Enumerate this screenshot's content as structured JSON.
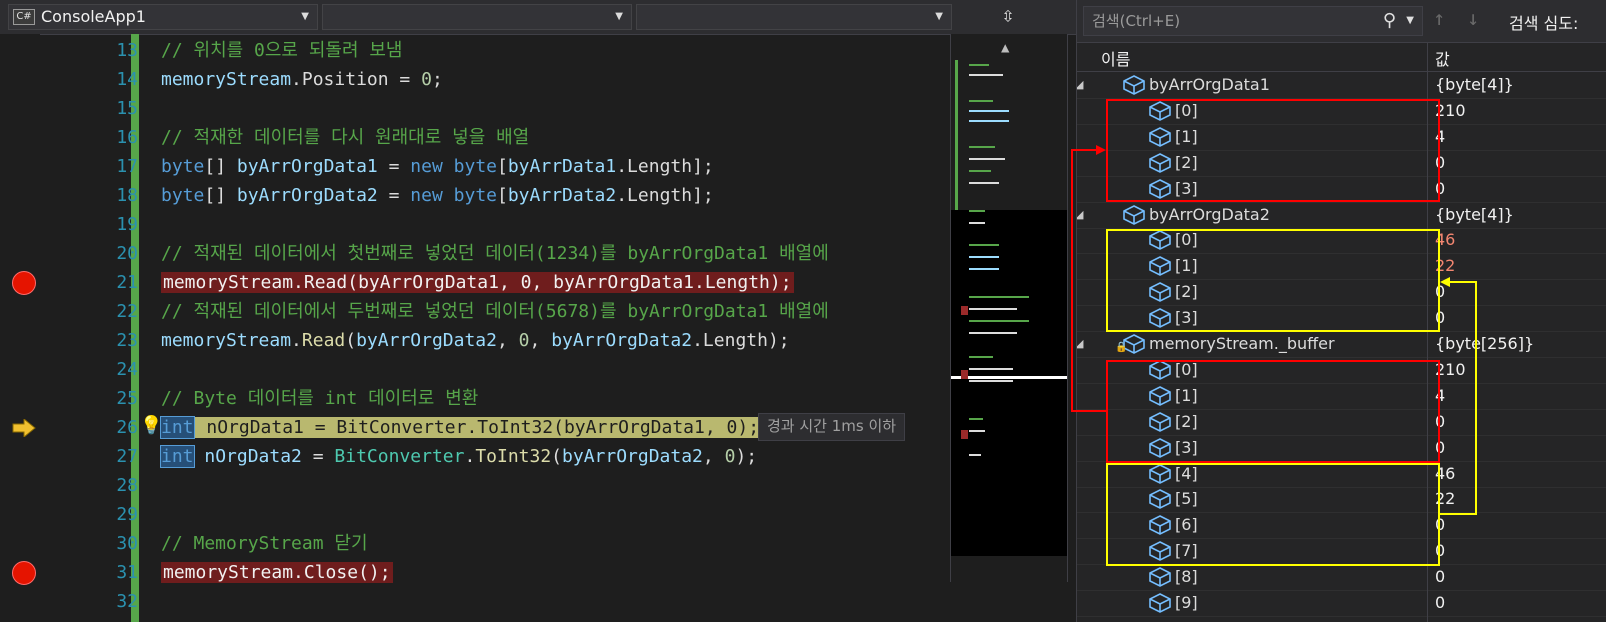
{
  "editor": {
    "nav": {
      "project": "ConsoleApp1",
      "project_icon": "C#",
      "type": "",
      "member": ""
    },
    "lines": [
      {
        "num": "13",
        "tokens": [
          {
            "t": "// 위치를 0으로 되돌려 보냄",
            "c": "comment"
          }
        ]
      },
      {
        "num": "14",
        "tokens": [
          {
            "t": "memoryStream",
            "c": "id"
          },
          {
            "t": ".Position = ",
            "c": "plain"
          },
          {
            "t": "0",
            "c": "num"
          },
          {
            "t": ";",
            "c": "plain"
          }
        ]
      },
      {
        "num": "15",
        "tokens": []
      },
      {
        "num": "16",
        "tokens": [
          {
            "t": "// 적재한 데이터를 다시 원래대로 넣을 배열",
            "c": "comment"
          }
        ]
      },
      {
        "num": "17",
        "tokens": [
          {
            "t": "byte",
            "c": "kw"
          },
          {
            "t": "[] ",
            "c": "plain"
          },
          {
            "t": "byArrOrgData1",
            "c": "id"
          },
          {
            "t": " = ",
            "c": "plain"
          },
          {
            "t": "new",
            "c": "kw"
          },
          {
            "t": " ",
            "c": "plain"
          },
          {
            "t": "byte",
            "c": "kw"
          },
          {
            "t": "[",
            "c": "plain"
          },
          {
            "t": "byArrData1",
            "c": "id"
          },
          {
            "t": ".Length];",
            "c": "plain"
          }
        ]
      },
      {
        "num": "18",
        "tokens": [
          {
            "t": "byte",
            "c": "kw"
          },
          {
            "t": "[] ",
            "c": "plain"
          },
          {
            "t": "byArrOrgData2",
            "c": "id"
          },
          {
            "t": " = ",
            "c": "plain"
          },
          {
            "t": "new",
            "c": "kw"
          },
          {
            "t": " ",
            "c": "plain"
          },
          {
            "t": "byte",
            "c": "kw"
          },
          {
            "t": "[",
            "c": "plain"
          },
          {
            "t": "byArrData2",
            "c": "id"
          },
          {
            "t": ".Length];",
            "c": "plain"
          }
        ]
      },
      {
        "num": "19",
        "tokens": []
      },
      {
        "num": "20",
        "tokens": [
          {
            "t": "// 적재된 데이터에서 첫번째로 넣었던 데이터(1234)를 byArrOrgData1 배열에",
            "c": "comment"
          }
        ]
      },
      {
        "num": "21",
        "breakpoint": true,
        "tokens": [
          {
            "t": "memoryStream.Read(byArrOrgData1, 0, byArrOrgData1.Length);",
            "c": "bp"
          }
        ]
      },
      {
        "num": "22",
        "tokens": [
          {
            "t": "// 적재된 데이터에서 두번째로 넣었던 데이터(5678)를 byArrOrgData1 배열에",
            "c": "comment"
          }
        ]
      },
      {
        "num": "23",
        "tokens": [
          {
            "t": "memoryStream",
            "c": "id"
          },
          {
            "t": ".",
            "c": "plain"
          },
          {
            "t": "Read",
            "c": "method"
          },
          {
            "t": "(",
            "c": "plain"
          },
          {
            "t": "byArrOrgData2",
            "c": "id"
          },
          {
            "t": ", ",
            "c": "plain"
          },
          {
            "t": "0",
            "c": "num"
          },
          {
            "t": ", ",
            "c": "plain"
          },
          {
            "t": "byArrOrgData2",
            "c": "id"
          },
          {
            "t": ".Length);",
            "c": "plain"
          }
        ]
      },
      {
        "num": "24",
        "tokens": []
      },
      {
        "num": "25",
        "tokens": [
          {
            "t": "// Byte 데이터를 int 데이터로 변환",
            "c": "comment"
          }
        ]
      },
      {
        "num": "26",
        "current": true,
        "tokens": [
          {
            "t": "int",
            "c": "kwsel"
          },
          {
            "t": " nOrgData1 = BitConverter.ToInt32(byArrOrgData1, 0);",
            "c": "cur"
          }
        ]
      },
      {
        "num": "27",
        "tokens": [
          {
            "t": "int",
            "c": "kwsel"
          },
          {
            "t": " ",
            "c": "plain"
          },
          {
            "t": "nOrgData2",
            "c": "id"
          },
          {
            "t": " = ",
            "c": "plain"
          },
          {
            "t": "BitConverter",
            "c": "type"
          },
          {
            "t": ".",
            "c": "plain"
          },
          {
            "t": "ToInt32",
            "c": "method"
          },
          {
            "t": "(",
            "c": "plain"
          },
          {
            "t": "byArrOrgData2",
            "c": "id"
          },
          {
            "t": ", ",
            "c": "plain"
          },
          {
            "t": "0",
            "c": "num"
          },
          {
            "t": ");",
            "c": "plain"
          }
        ]
      },
      {
        "num": "28",
        "tokens": []
      },
      {
        "num": "29",
        "tokens": []
      },
      {
        "num": "30",
        "tokens": [
          {
            "t": "// MemoryStream 닫기",
            "c": "comment"
          }
        ]
      },
      {
        "num": "31",
        "breakpoint": true,
        "tokens": [
          {
            "t": "memoryStream.Close();",
            "c": "bp"
          }
        ]
      },
      {
        "num": "32",
        "tokens": []
      }
    ],
    "perf_tip": "경과 시간 1ms 이하"
  },
  "watch": {
    "search_placeholder": "검색(Ctrl+E)",
    "search_depth_label": "검색 심도:",
    "header_name": "이름",
    "header_value": "값",
    "rows": [
      {
        "name": "byArrOrgData1",
        "value": "{byte[4]}",
        "level": 0,
        "expanded": true
      },
      {
        "name": "[0]",
        "value": "210",
        "level": 1
      },
      {
        "name": "[1]",
        "value": "4",
        "level": 1
      },
      {
        "name": "[2]",
        "value": "0",
        "level": 1
      },
      {
        "name": "[3]",
        "value": "0",
        "level": 1
      },
      {
        "name": "byArrOrgData2",
        "value": "{byte[4]}",
        "level": 0,
        "expanded": true
      },
      {
        "name": "[0]",
        "value": "46",
        "level": 1,
        "changed": true
      },
      {
        "name": "[1]",
        "value": "22",
        "level": 1,
        "changed": true
      },
      {
        "name": "[2]",
        "value": "0",
        "level": 1
      },
      {
        "name": "[3]",
        "value": "0",
        "level": 1
      },
      {
        "name": "memoryStream._buffer",
        "value": "{byte[256]}",
        "level": 0,
        "expanded": true,
        "locked": true
      },
      {
        "name": "[0]",
        "value": "210",
        "level": 1
      },
      {
        "name": "[1]",
        "value": "4",
        "level": 1
      },
      {
        "name": "[2]",
        "value": "0",
        "level": 1
      },
      {
        "name": "[3]",
        "value": "0",
        "level": 1
      },
      {
        "name": "[4]",
        "value": "46",
        "level": 1
      },
      {
        "name": "[5]",
        "value": "22",
        "level": 1
      },
      {
        "name": "[6]",
        "value": "0",
        "level": 1
      },
      {
        "name": "[7]",
        "value": "0",
        "level": 1
      },
      {
        "name": "[8]",
        "value": "0",
        "level": 1
      },
      {
        "name": "[9]",
        "value": "0",
        "level": 1
      }
    ]
  },
  "colors": {
    "annotation_red": "#ff0000",
    "annotation_yellow": "#ffff00",
    "breakpoint": "#e51400",
    "current_line": "#b9b86f"
  }
}
